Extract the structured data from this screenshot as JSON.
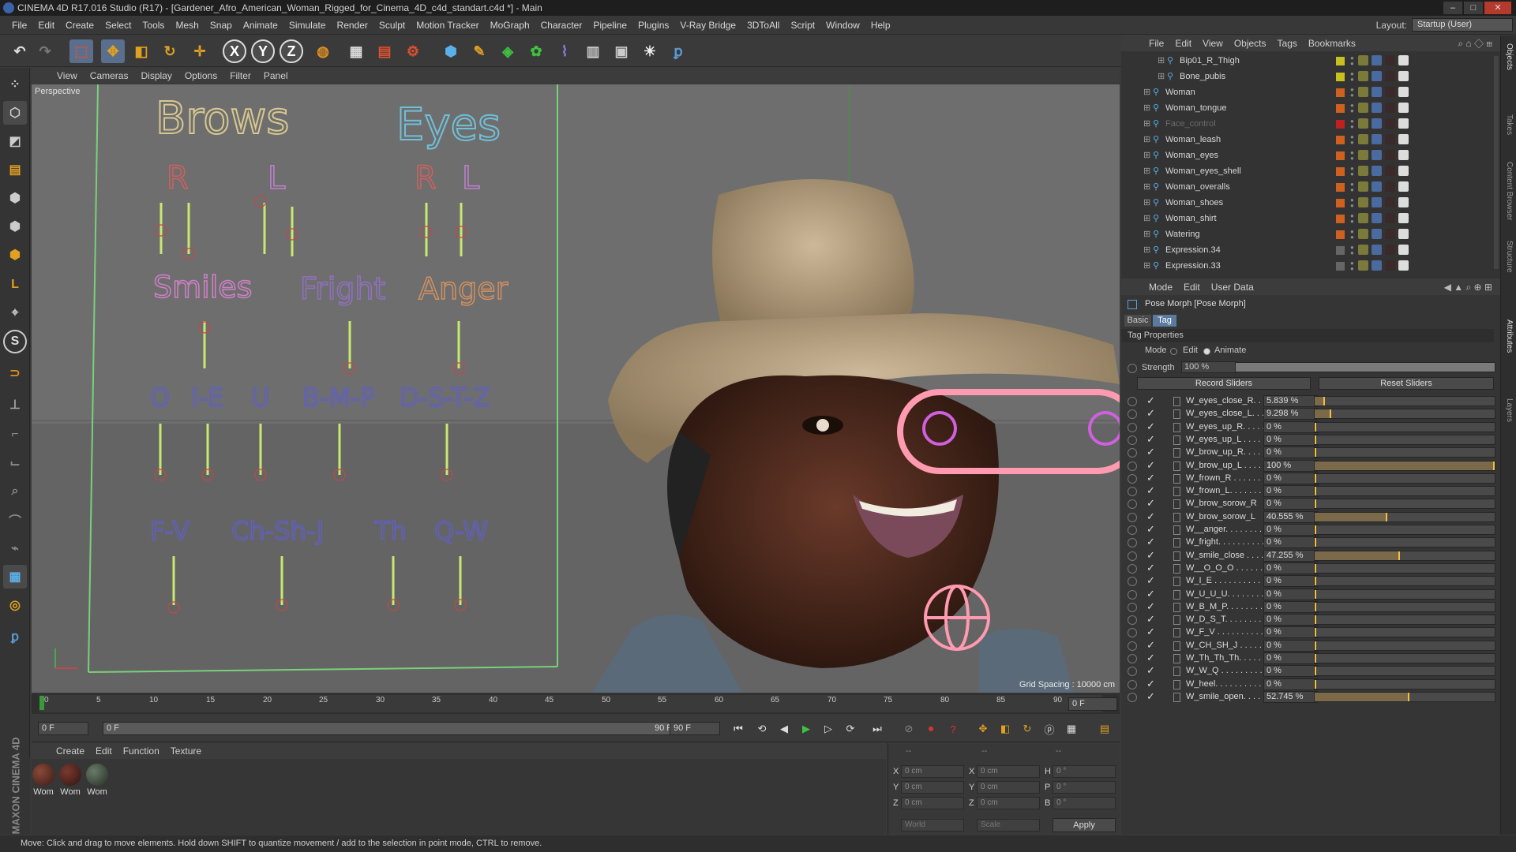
{
  "window": {
    "title": "CINEMA 4D R17.016 Studio (R17) - [Gardener_Afro_American_Woman_Rigged_for_Cinema_4D_c4d_standart.c4d *] - Main",
    "buttons": [
      "–",
      "□",
      "✕"
    ]
  },
  "menubar": {
    "items": [
      "File",
      "Edit",
      "Create",
      "Select",
      "Tools",
      "Mesh",
      "Snap",
      "Animate",
      "Simulate",
      "Render",
      "Sculpt",
      "Motion Tracker",
      "MoGraph",
      "Character",
      "Pipeline",
      "Plugins",
      "V-Ray Bridge",
      "3DToAll",
      "Script",
      "Window",
      "Help"
    ],
    "layout_label": "Layout:",
    "layout_value": "Startup (User)"
  },
  "toolbar": {
    "icons": [
      "undo-icon",
      "redo-icon",
      "live-select-icon",
      "move-icon",
      "scale-icon",
      "rotate-icon",
      "move-add-icon",
      "x-axis-icon",
      "y-axis-icon",
      "z-axis-icon",
      "coordinate-system-icon",
      "render-view-icon",
      "render-picture-viewer-icon",
      "render-settings-icon",
      "cube-icon",
      "pen-icon",
      "subdivision-icon",
      "mograph-icon",
      "deformer-icon",
      "floor-icon",
      "camera-icon",
      "light-icon",
      "python-icon"
    ],
    "axis_labels": [
      "X",
      "Y",
      "Z"
    ]
  },
  "left_toolbar": {
    "icons": [
      "points-mode-icon",
      "edges-mode-icon",
      "polygons-mode-icon",
      "object-mode-icon",
      "model-mode-icon",
      "texture-mode-icon",
      "axis-mode-icon",
      "uv-mode-icon",
      "workplane-icon",
      "tweak-icon",
      "solo-icon",
      "snap-icon",
      "magnet-icon",
      "brush-icon",
      "knife-icon",
      "bridge-icon",
      "extrude-icon",
      "smooth-icon",
      "grid-icon",
      "sculpt-icon",
      "python-script-icon"
    ],
    "letters": [
      "L",
      "S"
    ]
  },
  "viewport": {
    "menu": [
      "View",
      "Cameras",
      "Display",
      "Options",
      "Filter",
      "Panel"
    ],
    "label": "Perspective",
    "grid_spacing": "Grid Spacing : 10000 cm",
    "face_controls": {
      "groups": [
        "Brows",
        "Eyes",
        "Smiles",
        "Fright",
        "Anger"
      ],
      "side_labels": [
        "R",
        "L",
        "R",
        "L"
      ],
      "phonemes": [
        "O",
        "I-E",
        "U",
        "B-M-P",
        "D-S-T-Z",
        "F-V",
        "Ch-Sh-J",
        "Th",
        "Q-W"
      ]
    }
  },
  "timeline": {
    "ticks": [
      "0",
      "5",
      "10",
      "15",
      "20",
      "25",
      "30",
      "35",
      "40",
      "45",
      "50",
      "55",
      "60",
      "65",
      "70",
      "75",
      "80",
      "85",
      "90"
    ],
    "end_frame": "0 F"
  },
  "transport": {
    "start": "0 F",
    "range_start": "0 F",
    "range_end": "90 F",
    "end": "90 F"
  },
  "materials": {
    "menu": [
      "Create",
      "Edit",
      "Function",
      "Texture"
    ],
    "items": [
      {
        "label": "Wom",
        "color": "#5a2a22"
      },
      {
        "label": "Wom",
        "color": "#4a2420"
      },
      {
        "label": "Wom",
        "color": "#3d4a3a"
      }
    ]
  },
  "coordinates": {
    "headers": [
      "--",
      "--",
      "--"
    ],
    "rows": [
      {
        "a": "X",
        "av": "0 cm",
        "b": "X",
        "bv": "0 cm",
        "c": "H",
        "cv": "0 °"
      },
      {
        "a": "Y",
        "av": "0 cm",
        "b": "Y",
        "bv": "0 cm",
        "c": "P",
        "cv": "0 °"
      },
      {
        "a": "Z",
        "av": "0 cm",
        "b": "Z",
        "bv": "0 cm",
        "c": "B",
        "cv": "0 °"
      }
    ],
    "mode1": "World",
    "mode2": "Scale",
    "apply": "Apply"
  },
  "object_manager": {
    "menu": [
      "File",
      "Edit",
      "View",
      "Objects",
      "Tags",
      "Bookmarks"
    ],
    "objects": [
      {
        "name": "Bip01_R_Thigh",
        "indent": 68,
        "layer": "#c8c020",
        "dim": false
      },
      {
        "name": "Bone_pubis",
        "indent": 68,
        "layer": "#c8c020",
        "dim": false
      },
      {
        "name": "Woman",
        "indent": 50,
        "layer": "#d06020",
        "dim": false
      },
      {
        "name": "Woman_tongue",
        "indent": 50,
        "layer": "#d06020",
        "dim": false
      },
      {
        "name": "Face_control",
        "indent": 50,
        "layer": "#c02020",
        "dim": true
      },
      {
        "name": "Woman_leash",
        "indent": 50,
        "layer": "#d06020",
        "dim": false
      },
      {
        "name": "Woman_eyes",
        "indent": 50,
        "layer": "#d06020",
        "dim": false
      },
      {
        "name": "Woman_eyes_shell",
        "indent": 50,
        "layer": "#d06020",
        "dim": false
      },
      {
        "name": "Woman_overalls",
        "indent": 50,
        "layer": "#d06020",
        "dim": false
      },
      {
        "name": "Woman_shoes",
        "indent": 50,
        "layer": "#d06020",
        "dim": false
      },
      {
        "name": "Woman_shirt",
        "indent": 50,
        "layer": "#d06020",
        "dim": false
      },
      {
        "name": "Watering",
        "indent": 50,
        "layer": "#d06020",
        "dim": false
      },
      {
        "name": "Expression.34",
        "indent": 50,
        "layer": "#666666",
        "dim": false
      },
      {
        "name": "Expression.33",
        "indent": 50,
        "layer": "#666666",
        "dim": false
      }
    ]
  },
  "attributes": {
    "menu": [
      "Mode",
      "Edit",
      "User Data"
    ],
    "title": "Pose Morph [Pose Morph]",
    "tabs": [
      "Basic",
      "Tag"
    ],
    "section": "Tag Properties",
    "mode_label": "Mode",
    "mode_edit": "Edit",
    "mode_animate": "Animate",
    "strength_label": "Strength",
    "strength_value": "100 %",
    "strength_level": 1.0,
    "record": "Record Sliders",
    "reset": "Reset Sliders",
    "sliders": [
      {
        "name": "W_eyes_close_R. . . .",
        "value": "5.839 %",
        "level": 0.05839
      },
      {
        "name": "W_eyes_close_L. . . .",
        "value": "9.298 %",
        "level": 0.09298
      },
      {
        "name": "W_eyes_up_R. . . . . .",
        "value": "0 %",
        "level": 0
      },
      {
        "name": "W_eyes_up_L . . . . . .",
        "value": "0 %",
        "level": 0
      },
      {
        "name": "W_brow_up_R. . . . . .",
        "value": "0 %",
        "level": 0
      },
      {
        "name": "W_brow_up_L . . . . .",
        "value": "100 %",
        "level": 1.0
      },
      {
        "name": "W_frown_R . . . . . . .",
        "value": "0 %",
        "level": 0
      },
      {
        "name": "W_frown_L. . . . . . . .",
        "value": "0 %",
        "level": 0
      },
      {
        "name": "W_brow_sorow_R",
        "value": "0 %",
        "level": 0
      },
      {
        "name": "W_brow_sorow_L",
        "value": "40.555 %",
        "level": 0.40555
      },
      {
        "name": "W__anger. . . . . . . .",
        "value": "0 %",
        "level": 0
      },
      {
        "name": "W_fright. . . . . . . . . .",
        "value": "0 %",
        "level": 0
      },
      {
        "name": "W_smile_close . . . .",
        "value": "47.255 %",
        "level": 0.47255
      },
      {
        "name": "W__O_O_O . . . . . .",
        "value": "0 %",
        "level": 0
      },
      {
        "name": "W_I_E . . . . . . . . . . .",
        "value": "0 %",
        "level": 0
      },
      {
        "name": "W_U_U_U. . . . . . . .",
        "value": "0 %",
        "level": 0
      },
      {
        "name": "W_B_M_P. . . . . . . .",
        "value": "0 %",
        "level": 0
      },
      {
        "name": "W_D_S_T. . . . . . . . .",
        "value": "0 %",
        "level": 0
      },
      {
        "name": "W_F_V . . . . . . . . . .",
        "value": "0 %",
        "level": 0
      },
      {
        "name": "W_CH_SH_J . . . . . .",
        "value": "0 %",
        "level": 0
      },
      {
        "name": "W_Th_Th_Th. . . . . .",
        "value": "0 %",
        "level": 0
      },
      {
        "name": "W_W_Q . . . . . . . . .",
        "value": "0 %",
        "level": 0
      },
      {
        "name": "W_heel. . . . . . . . . . .",
        "value": "0 %",
        "level": 0
      },
      {
        "name": "W_smile_open. . . . .",
        "value": "52.745 %",
        "level": 0.52745
      }
    ]
  },
  "right_strip": [
    "Objects",
    "Takes",
    "Content Browser",
    "Structure",
    "Attributes",
    "Layers"
  ],
  "status": "Move: Click and drag to move elements. Hold down SHIFT to quantize movement / add to the selection in point mode, CTRL to remove.",
  "maxon": "MAXON CINEMA 4D"
}
